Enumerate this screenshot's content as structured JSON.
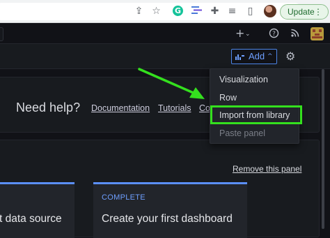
{
  "browser": {
    "update_label": "Update",
    "update_menu_icon": "⋮",
    "icons": [
      "share-icon",
      "bookmark-star-icon",
      "grammarly-icon",
      "extension-icon",
      "puzzle-icon",
      "reading-list-icon",
      "sidebar-icon",
      "profile-avatar",
      "kebab-menu-icon"
    ]
  },
  "grafana": {
    "top_icons": [
      "plus-icon",
      "chevron-down-icon",
      "help-icon",
      "rss-icon",
      "user-avatar"
    ],
    "toolbar": {
      "add_label": "Add",
      "add_chevron": "^"
    },
    "help": {
      "title": "Need help?",
      "links": [
        "Documentation",
        "Tutorials",
        "Co"
      ]
    },
    "setup": {
      "remove_label": "Remove this panel",
      "cards": [
        {
          "status": "",
          "title": "t data source"
        },
        {
          "status": "COMPLETE",
          "title": "Create your first dashboard"
        }
      ]
    },
    "add_menu": {
      "items": [
        {
          "label": "Visualization",
          "disabled": false
        },
        {
          "label": "Row",
          "disabled": false
        },
        {
          "label": "Import from library",
          "disabled": false,
          "highlighted": true
        },
        {
          "label": "Paste panel",
          "disabled": true
        }
      ]
    }
  },
  "colors": {
    "accent": "#6e9fff",
    "highlight": "#34e01e",
    "background": "#111217",
    "panel": "#181b1f"
  }
}
